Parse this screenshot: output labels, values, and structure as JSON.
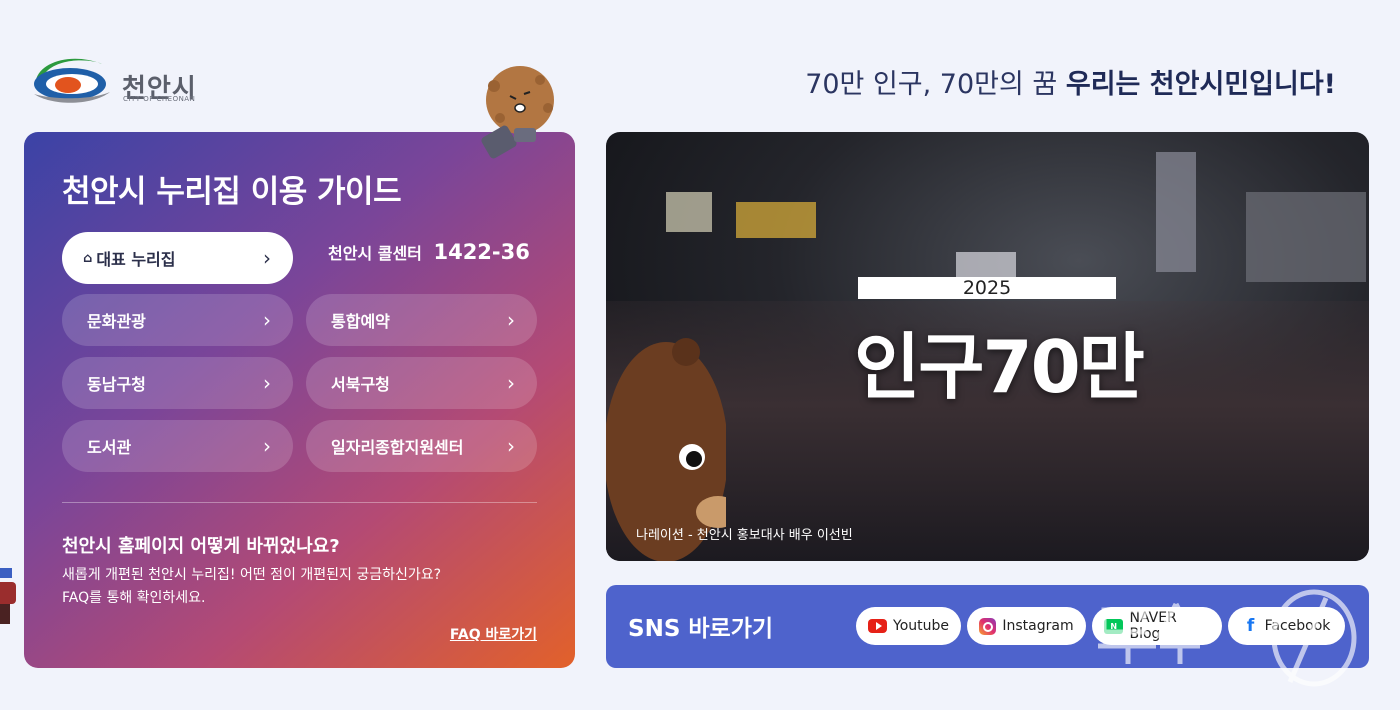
{
  "logo": {
    "name_ko": "천안시",
    "name_en": "CITY OF CHEONAN"
  },
  "slogan": {
    "prefix": "70만 인구, 70만의 꿈",
    "emphasis": "우리는 천안시민입니다!"
  },
  "guide": {
    "title": "천안시 누리집 이용 가이드",
    "links": [
      {
        "label": "대표 누리집",
        "icon": "home-icon",
        "primary": true
      },
      {
        "label": "문화관광"
      },
      {
        "label": "통합예약"
      },
      {
        "label": "동남구청"
      },
      {
        "label": "서북구청"
      },
      {
        "label": "도서관"
      },
      {
        "label": "일자리종합지원센터"
      }
    ],
    "chevron": "›",
    "call_label": "천안시 콜센터",
    "call_number": "1422-36",
    "faq": {
      "title": "천안시 홈페이지 어떻게 바뀌었나요?",
      "desc_line1": "새롭게 개편된 천안시 누리집! 어떤 점이 개편된지 궁금하신가요?",
      "desc_line2": "FAQ를 통해 확인하세요.",
      "link": "FAQ 바로가기"
    }
  },
  "video": {
    "year": "2025",
    "headline": "인구70만",
    "caption": "나레이션 - 천안시 홍보대사 배우 이선빈"
  },
  "sns": {
    "title": "SNS 바로가기",
    "buttons": [
      {
        "label": "Youtube",
        "icon": "youtube-icon"
      },
      {
        "label": "Instagram",
        "icon": "instagram-icon"
      },
      {
        "label": "NAVER Blog",
        "icon": "naver-blog-icon"
      },
      {
        "label": "Facebook",
        "icon": "facebook-icon"
      }
    ]
  },
  "colors": {
    "page_bg": "#f1f3fb",
    "sns_bg": "#4e63cc",
    "guide_gradient_start": "#3b43a6",
    "guide_gradient_end": "#e2612a"
  }
}
